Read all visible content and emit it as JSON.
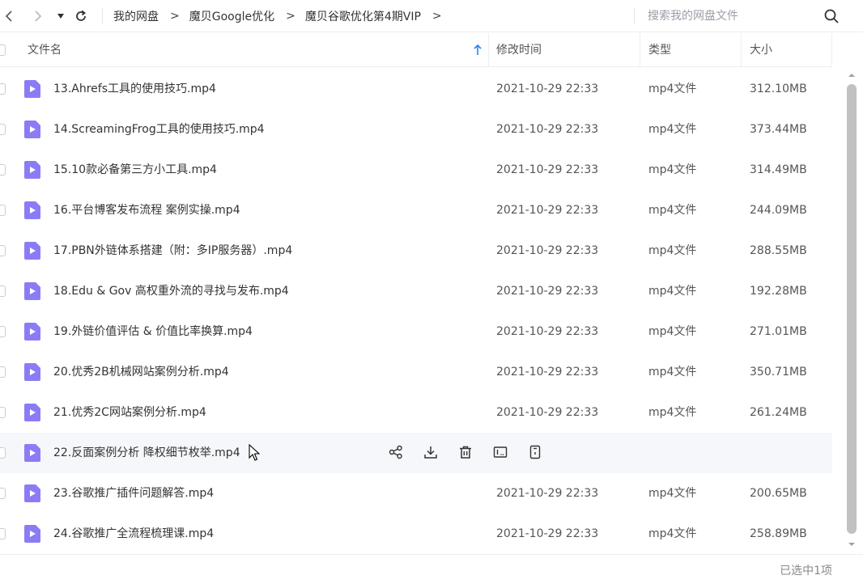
{
  "nav": {
    "breadcrumbs": [
      "我的网盘",
      "魔贝Google优化",
      "魔贝谷歌优化第4期VIP"
    ],
    "separator": ">",
    "search_placeholder": "搜索我的网盘文件"
  },
  "table": {
    "headers": {
      "name": "文件名",
      "date": "修改时间",
      "type": "类型",
      "size": "大小"
    },
    "sort_indicator": "arrow-up-icon",
    "rows": [
      {
        "name": "13.Ahrefs工具的使用技巧.mp4",
        "date": "2021-10-29 22:33",
        "type": "mp4文件",
        "size": "312.10MB"
      },
      {
        "name": "14.ScreamingFrog工具的使用技巧.mp4",
        "date": "2021-10-29 22:33",
        "type": "mp4文件",
        "size": "373.44MB"
      },
      {
        "name": "15.10款必备第三方小工具.mp4",
        "date": "2021-10-29 22:33",
        "type": "mp4文件",
        "size": "314.49MB"
      },
      {
        "name": "16.平台博客发布流程 案例实操.mp4",
        "date": "2021-10-29 22:33",
        "type": "mp4文件",
        "size": "244.09MB"
      },
      {
        "name": "17.PBN外链体系搭建（附：多IP服务器）.mp4",
        "date": "2021-10-29 22:33",
        "type": "mp4文件",
        "size": "288.55MB"
      },
      {
        "name": "18.Edu & Gov 高权重外流的寻找与发布.mp4",
        "date": "2021-10-29 22:33",
        "type": "mp4文件",
        "size": "192.28MB"
      },
      {
        "name": "19.外链价值评估 & 价值比率换算.mp4",
        "date": "2021-10-29 22:33",
        "type": "mp4文件",
        "size": "271.01MB"
      },
      {
        "name": "20.优秀2B机械网站案例分析.mp4",
        "date": "2021-10-29 22:33",
        "type": "mp4文件",
        "size": "350.71MB"
      },
      {
        "name": "21.优秀2C网站案例分析.mp4",
        "date": "2021-10-29 22:33",
        "type": "mp4文件",
        "size": "261.24MB"
      },
      {
        "name": "22.反面案例分析 降权细节枚举.mp4",
        "hovered": true
      },
      {
        "name": "23.谷歌推广插件问题解答.mp4",
        "date": "2021-10-29 22:33",
        "type": "mp4文件",
        "size": "200.65MB"
      },
      {
        "name": "24.谷歌推广全流程梳理课.mp4",
        "date": "2021-10-29 22:33",
        "type": "mp4文件",
        "size": "258.89MB"
      }
    ],
    "hover_actions": [
      "share-icon",
      "download-icon",
      "delete-icon",
      "rename-icon",
      "more-icon"
    ]
  },
  "footer": {
    "status": "已选中1项"
  },
  "colors": {
    "file_icon": "#8b7cf6",
    "sort_arrow": "#2f7df6",
    "hover_row": "#f5f7fa"
  }
}
